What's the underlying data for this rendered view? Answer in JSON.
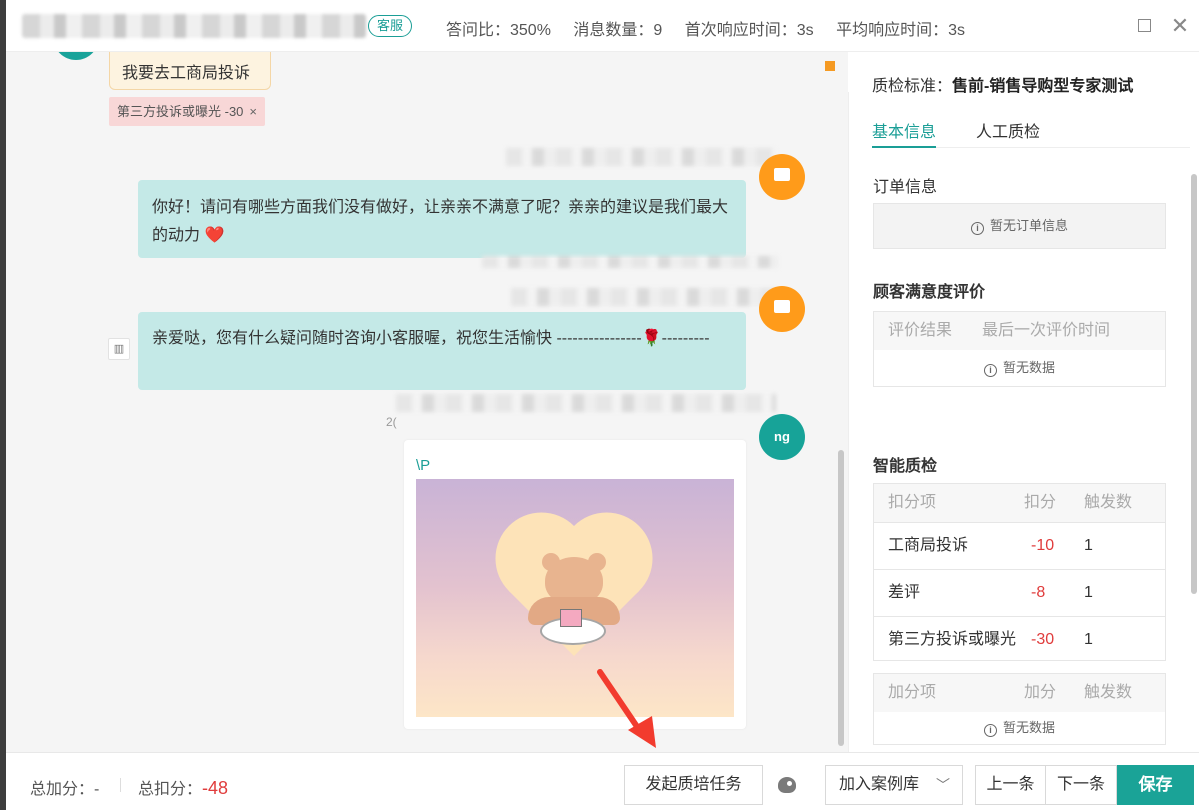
{
  "header": {
    "service_tag": "客服",
    "stats": {
      "answer_ratio": "答问比：350%",
      "message_count": "消息数量：9",
      "first_response": "首次响应时间：3s",
      "avg_response": "平均响应时间：3s"
    }
  },
  "chat": {
    "complaint_message": "我要去工商局投诉",
    "deduction_tag": "第三方投诉或曝光 -30",
    "deduction_tag_close": "×",
    "agent_message_1": "你好！请问有哪些方面我们没有做好，让亲亲不满意了呢？亲亲的建议是我们最大的动力 ❤️",
    "agent_message_2": "亲爱哒，您有什么疑问随时咨询小客服喔，祝您生活愉快 ----------------🌹---------",
    "timestamp_fragment": "2(",
    "avatar_label": "ng",
    "image_caption": "\\P"
  },
  "right_panel": {
    "standard_label": "质检标准：",
    "standard_value": "售前-销售导购型专家测试",
    "tabs": [
      "基本信息",
      "人工质检"
    ],
    "order_info": {
      "title": "订单信息",
      "empty": "暂无订单信息"
    },
    "satisfaction": {
      "title": "顾客满意度评价",
      "headers": [
        "评价结果",
        "最后一次评价时间"
      ],
      "empty": "暂无数据"
    },
    "smart_qc": {
      "title": "智能质检",
      "deduct_headers": [
        "扣分项",
        "扣分",
        "触发数"
      ],
      "deduct_rows": [
        {
          "item": "工商局投诉",
          "points": "-10",
          "count": "1"
        },
        {
          "item": "差评",
          "points": "-8",
          "count": "1"
        },
        {
          "item": "第三方投诉或曝光",
          "points": "-30",
          "count": "1"
        }
      ],
      "add_headers": [
        "加分项",
        "加分",
        "触发数"
      ],
      "add_empty": "暂无数据"
    }
  },
  "bottom": {
    "total_add_label": "总加分：",
    "total_add_value": "-",
    "total_deduct_label": "总扣分：",
    "total_deduct_value": "-48",
    "task_button": "发起质培任务",
    "case_button": "加入案例库",
    "prev_button": "上一条",
    "next_button": "下一条",
    "save_button": "保存"
  },
  "colors": {
    "accent": "#1aa397",
    "danger": "#e03c3c",
    "bubble": "#c4e9e7"
  }
}
